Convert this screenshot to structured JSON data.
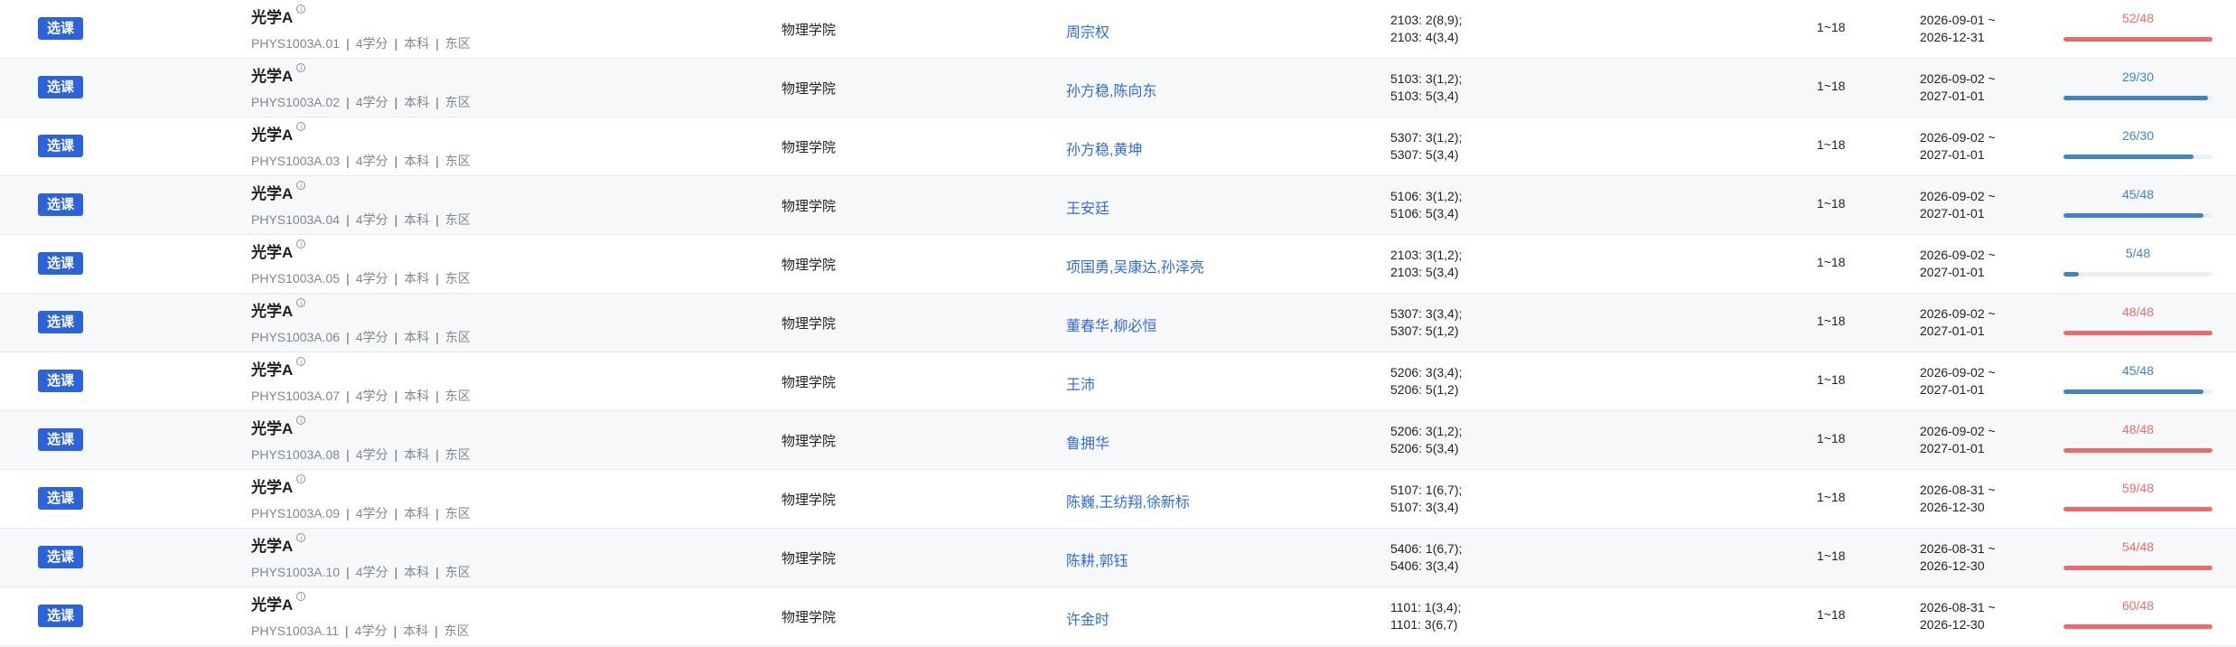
{
  "colors": {
    "accent": "#2d63d8",
    "bar_available": "#3d85c6",
    "bar_full": "#ee6a6a",
    "label_full": "#ee6a6a",
    "label_available": "#3d85c6"
  },
  "rows": [
    {
      "btn": "选课",
      "title": "光学A",
      "code": "PHYS1003A.01",
      "credits": "4学分",
      "level": "本科",
      "campus": "东区",
      "school": "物理学院",
      "teachers": "周宗权",
      "time1": "2103: 2(8,9);",
      "time2": "2103: 4(3,4)",
      "weeks": "1~18",
      "date1": "2026-09-01 ~",
      "date2": "2026-12-31",
      "cap": "52/48",
      "ratio": 1.0,
      "full": true
    },
    {
      "btn": "选课",
      "title": "光学A",
      "code": "PHYS1003A.02",
      "credits": "4学分",
      "level": "本科",
      "campus": "东区",
      "school": "物理学院",
      "teachers": "孙方稳,陈向东",
      "time1": "5103: 3(1,2);",
      "time2": "5103: 5(3,4)",
      "weeks": "1~18",
      "date1": "2026-09-02 ~",
      "date2": "2027-01-01",
      "cap": "29/30",
      "ratio": 0.97,
      "full": false
    },
    {
      "btn": "选课",
      "title": "光学A",
      "code": "PHYS1003A.03",
      "credits": "4学分",
      "level": "本科",
      "campus": "东区",
      "school": "物理学院",
      "teachers": "孙方稳,黄坤",
      "time1": "5307: 3(1,2);",
      "time2": "5307: 5(3,4)",
      "weeks": "1~18",
      "date1": "2026-09-02 ~",
      "date2": "2027-01-01",
      "cap": "26/30",
      "ratio": 0.87,
      "full": false
    },
    {
      "btn": "选课",
      "title": "光学A",
      "code": "PHYS1003A.04",
      "credits": "4学分",
      "level": "本科",
      "campus": "东区",
      "school": "物理学院",
      "teachers": "王安廷",
      "time1": "5106: 3(1,2);",
      "time2": "5106: 5(3,4)",
      "weeks": "1~18",
      "date1": "2026-09-02 ~",
      "date2": "2027-01-01",
      "cap": "45/48",
      "ratio": 0.94,
      "full": false
    },
    {
      "btn": "选课",
      "title": "光学A",
      "code": "PHYS1003A.05",
      "credits": "4学分",
      "level": "本科",
      "campus": "东区",
      "school": "物理学院",
      "teachers": "项国勇,吴康达,孙泽亮",
      "time1": "2103: 3(1,2);",
      "time2": "2103: 5(3,4)",
      "weeks": "1~18",
      "date1": "2026-09-02 ~",
      "date2": "2027-01-01",
      "cap": "5/48",
      "ratio": 0.1,
      "full": false
    },
    {
      "btn": "选课",
      "title": "光学A",
      "code": "PHYS1003A.06",
      "credits": "4学分",
      "level": "本科",
      "campus": "东区",
      "school": "物理学院",
      "teachers": "董春华,柳必恒",
      "time1": "5307: 3(3,4);",
      "time2": "5307: 5(1,2)",
      "weeks": "1~18",
      "date1": "2026-09-02 ~",
      "date2": "2027-01-01",
      "cap": "48/48",
      "ratio": 1.0,
      "full": true
    },
    {
      "btn": "选课",
      "title": "光学A",
      "code": "PHYS1003A.07",
      "credits": "4学分",
      "level": "本科",
      "campus": "东区",
      "school": "物理学院",
      "teachers": "王沛",
      "time1": "5206: 3(3,4);",
      "time2": "5206: 5(1,2)",
      "weeks": "1~18",
      "date1": "2026-09-02 ~",
      "date2": "2027-01-01",
      "cap": "45/48",
      "ratio": 0.94,
      "full": false
    },
    {
      "btn": "选课",
      "title": "光学A",
      "code": "PHYS1003A.08",
      "credits": "4学分",
      "level": "本科",
      "campus": "东区",
      "school": "物理学院",
      "teachers": "鲁拥华",
      "time1": "5206: 3(1,2);",
      "time2": "5206: 5(3,4)",
      "weeks": "1~18",
      "date1": "2026-09-02 ~",
      "date2": "2027-01-01",
      "cap": "48/48",
      "ratio": 1.0,
      "full": true
    },
    {
      "btn": "选课",
      "title": "光学A",
      "code": "PHYS1003A.09",
      "credits": "4学分",
      "level": "本科",
      "campus": "东区",
      "school": "物理学院",
      "teachers": "陈巍,王纺翔,徐新标",
      "time1": "5107: 1(6,7);",
      "time2": "5107: 3(3,4)",
      "weeks": "1~18",
      "date1": "2026-08-31 ~",
      "date2": "2026-12-30",
      "cap": "59/48",
      "ratio": 1.0,
      "full": true
    },
    {
      "btn": "选课",
      "title": "光学A",
      "code": "PHYS1003A.10",
      "credits": "4学分",
      "level": "本科",
      "campus": "东区",
      "school": "物理学院",
      "teachers": "陈耕,郭钰",
      "time1": "5406: 1(6,7);",
      "time2": "5406: 3(3,4)",
      "weeks": "1~18",
      "date1": "2026-08-31 ~",
      "date2": "2026-12-30",
      "cap": "54/48",
      "ratio": 1.0,
      "full": true
    },
    {
      "btn": "选课",
      "title": "光学A",
      "code": "PHYS1003A.11",
      "credits": "4学分",
      "level": "本科",
      "campus": "东区",
      "school": "物理学院",
      "teachers": "许金时",
      "time1": "1101: 1(3,4);",
      "time2": "1101: 3(6,7)",
      "weeks": "1~18",
      "date1": "2026-08-31 ~",
      "date2": "2026-12-30",
      "cap": "60/48",
      "ratio": 1.0,
      "full": true
    }
  ]
}
